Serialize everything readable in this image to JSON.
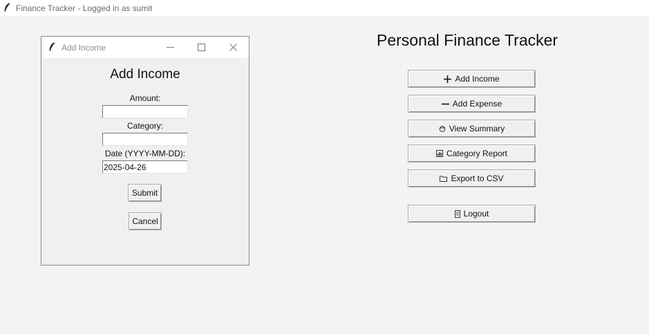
{
  "main_window": {
    "title": "Finance Tracker - Logged in as sumit",
    "heading": "Personal Finance Tracker",
    "buttons": {
      "add_income": "Add Income",
      "add_expense": "Add Expense",
      "view_summary": "View Summary",
      "category_report": "Category Report",
      "export_csv": "Export to CSV",
      "logout": "Logout"
    },
    "button_icons": [
      "plus-icon",
      "minus-icon",
      "summary-icon",
      "bar-chart-icon",
      "folder-icon",
      "door-icon"
    ]
  },
  "dialog": {
    "title": "Add Income",
    "heading": "Add Income",
    "amount_label": "Amount:",
    "amount_value": "",
    "category_label": "Category:",
    "category_value": "",
    "date_label": "Date (YYYY-MM-DD):",
    "date_value": "2025-04-26",
    "submit_label": "Submit",
    "cancel_label": "Cancel"
  },
  "colors": {
    "window_bg": "#f3f3f3",
    "titlebar_bg": "#ffffff",
    "button_bg": "#f0f0f0"
  }
}
